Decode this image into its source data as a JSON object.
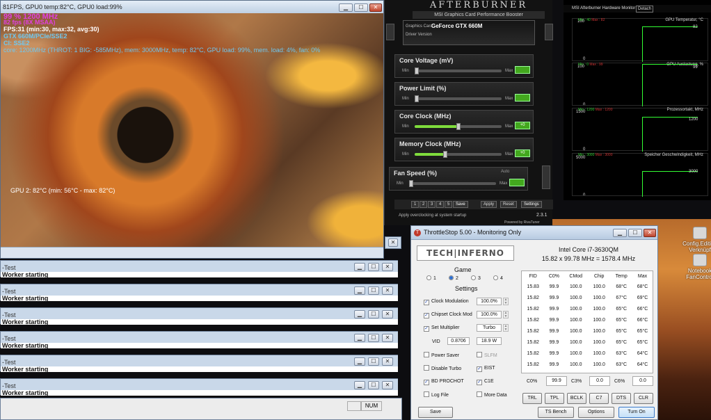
{
  "main_window": {
    "title": "81FPS, GPU0 temp:82°C, GPU0 load:99%",
    "overlay": {
      "fps": "99 % 1200 MHz",
      "line2": "82 fps (8X MSAA)",
      "line3": "FPS:31 (min:30, max:32, avg:30)",
      "line4": "GTX 660M/PCIe/SSE2",
      "line5": "CI: SSE2",
      "line6": "core: 1200MHz (THROT: 1 BIG: -585MHz), mem: 3000MHz, temp: 82°C, GPU load: 99%, mem. load: 4%, fan: 0%",
      "gpu_temp": "GPU 2: 82°C (min: 56°C - max: 82°C)"
    },
    "status_num": "NUM"
  },
  "consoles": [
    {
      "title": "-Test",
      "body": "Worker starting"
    },
    {
      "title": "-Test",
      "body": "Worker starting"
    },
    {
      "title": "-Test",
      "body": "Worker starting"
    },
    {
      "title": "-Test",
      "body": "Worker starting"
    },
    {
      "title": "-Test",
      "body": "Worker starting"
    },
    {
      "title": "-Test",
      "body": "Worker starting"
    }
  ],
  "afterburner": {
    "brand": "AFTERBURNER",
    "subtitle": "MSI Graphics Card Performance Booster",
    "graphics_card_label": "Graphics Card",
    "graphics_card": "GeForce GTX 660M",
    "driver_label": "Driver Version",
    "sliders": [
      {
        "label": "Core Voltage (mV)",
        "min": "Min",
        "max": "Max",
        "level": 0.0
      },
      {
        "label": "Power Limit (%)",
        "min": "Min",
        "max": "Max",
        "level": 0.0
      },
      {
        "label": "Core Clock (MHz)",
        "min": "Min",
        "max": "Max",
        "level": 0.5
      },
      {
        "label": "Memory Clock (MHz)",
        "min": "Min",
        "max": "Max",
        "level": 0.35
      },
      {
        "label": "Fan Speed (%)",
        "min": "Min",
        "max": "Max",
        "level": 0.0,
        "extra": "Auto"
      }
    ],
    "buttons": {
      "save": "Save",
      "apply": "Apply",
      "reset": "Reset",
      "settings": "Settings"
    },
    "profiles": [
      "1",
      "2",
      "3",
      "4",
      "5"
    ],
    "startup_text": "Apply overclocking at system startup",
    "version": "2.3.1",
    "powered_by": "Powered by RivaTuner"
  },
  "hw_monitor": {
    "title": "MSI Afterburner Hardware Monitor",
    "detach": "Detach",
    "graphs": [
      {
        "name": "GPU Temperatur, °C",
        "min": "Min : 40",
        "max": "Max : 82",
        "top": "100",
        "bottom": "0",
        "value": "82",
        "level": 0.82
      },
      {
        "name": "GPU Auslastung, %",
        "min": "Min : 0",
        "max": "Max : 99",
        "top": "100",
        "bottom": "0",
        "value": "99",
        "level": 0.99
      },
      {
        "name": "Prozessortakt, MHz",
        "min": "Min : 1200",
        "max": "Max : 1200",
        "top": "1500",
        "bottom": "0",
        "value": "1200",
        "level": 0.8
      },
      {
        "name": "Speicher Geschwindigkeit, MHz",
        "min": "Min : 3000",
        "max": "Max : 3000",
        "top": "5000",
        "bottom": "0",
        "value": "3000",
        "level": 0.6
      }
    ]
  },
  "throttlestop": {
    "title": "ThrottleStop 5.00 - Monitoring Only",
    "logo": "TECH|INFERNO",
    "cpu": "Intel Core i7-3630QM",
    "freq": "15.82 x 99.78 MHz = 1578.4 MHz",
    "game_label": "Game",
    "profiles": [
      "1",
      "2",
      "3",
      "4"
    ],
    "selected_profile": "2",
    "settings_label": "Settings",
    "clock_modulation": {
      "label": "Clock Modulation",
      "value": "100.0%"
    },
    "chipset_clock_mod": {
      "label": "Chipset Clock Mod",
      "value": "100.0%"
    },
    "set_multiplier": {
      "label": "Set Multiplier",
      "value": "Turbo"
    },
    "vid": {
      "label": "VID",
      "value": "0.8706",
      "power": "18.9 W"
    },
    "options": {
      "power_saver": "Power Saver",
      "slfm": "SLFM",
      "disable_turbo": "Disable Turbo",
      "eist": "EIST",
      "bd_prochot": "BD PROCHOT",
      "c1e": "C1E",
      "log_file": "Log File",
      "more_data": "More Data"
    },
    "table_headers": [
      "FID",
      "C0%",
      "CMod",
      "Chip",
      "Temp",
      "Max"
    ],
    "table_rows": [
      [
        "15.83",
        "99.9",
        "100.0",
        "100.0",
        "68°C",
        "68°C"
      ],
      [
        "15.82",
        "99.9",
        "100.0",
        "100.0",
        "67°C",
        "69°C"
      ],
      [
        "15.82",
        "99.9",
        "100.0",
        "100.0",
        "65°C",
        "66°C"
      ],
      [
        "15.82",
        "99.9",
        "100.0",
        "100.0",
        "65°C",
        "66°C"
      ],
      [
        "15.82",
        "99.9",
        "100.0",
        "100.0",
        "65°C",
        "65°C"
      ],
      [
        "15.82",
        "99.9",
        "100.0",
        "100.0",
        "65°C",
        "65°C"
      ],
      [
        "15.82",
        "99.9",
        "100.0",
        "100.0",
        "63°C",
        "64°C"
      ],
      [
        "15.82",
        "99.9",
        "100.0",
        "100.0",
        "63°C",
        "64°C"
      ]
    ],
    "summary": [
      {
        "label": "C0%",
        "value": "99.9"
      },
      {
        "label": "C3%",
        "value": "0.0"
      },
      {
        "label": "C6%",
        "value": "0.0"
      }
    ],
    "row_buttons": [
      "TRL",
      "TPL",
      "BCLK",
      "C7",
      "DTS",
      "CLR"
    ],
    "bottom_buttons": {
      "save": "Save",
      "ts_bench": "TS Bench",
      "options": "Options",
      "turn_on": "Turn On"
    }
  },
  "desktop_icons": [
    {
      "label": "Config.Edition",
      "label2": "Verknüpf"
    },
    {
      "label": "Notebook",
      "label2": "FanControl"
    }
  ]
}
